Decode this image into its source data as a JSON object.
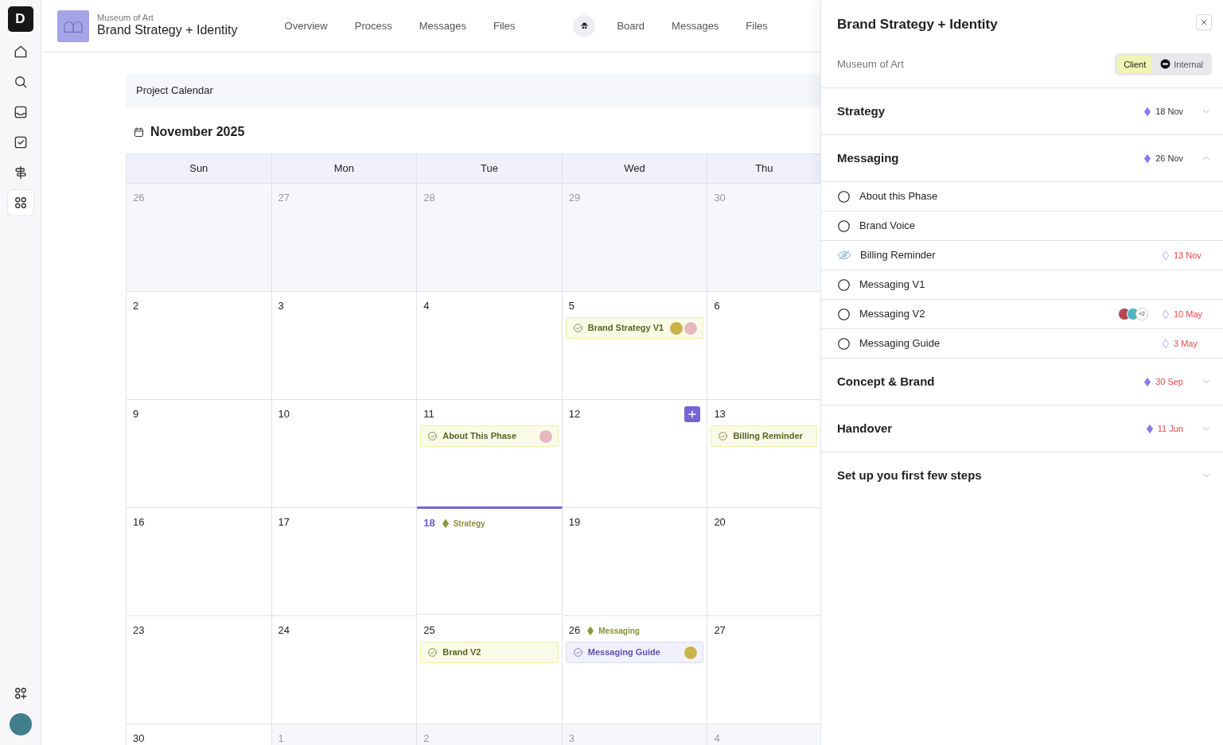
{
  "rail": {
    "logo": "D",
    "items": [
      {
        "kind": "home",
        "selected": false
      },
      {
        "kind": "search",
        "selected": false
      },
      {
        "kind": "inbox",
        "selected": false
      },
      {
        "kind": "tasks",
        "selected": false
      },
      {
        "kind": "signpost",
        "selected": false
      },
      {
        "kind": "apps",
        "selected": true
      }
    ],
    "bottom": [
      {
        "kind": "add-apps"
      },
      {
        "kind": "avatar",
        "color": "#3f7f8c"
      }
    ]
  },
  "header": {
    "org": "Museum of Art",
    "title": "Brand Strategy + Identity",
    "tabs": [
      {
        "label": "Overview",
        "selected": false
      },
      {
        "label": "Process",
        "selected": false
      },
      {
        "label": "Messages",
        "selected": false
      },
      {
        "label": "Files",
        "selected": false
      }
    ],
    "internal_tabs": [
      {
        "label": "Board",
        "selected": false
      },
      {
        "label": "Messages",
        "selected": false
      },
      {
        "label": "Files",
        "selected": false
      }
    ]
  },
  "calendar": {
    "title": "Project Calendar",
    "month": "November 2025",
    "weekdays": [
      "Sun",
      "Mon",
      "Tue",
      "Wed",
      "Thu"
    ],
    "weeks": [
      [
        {
          "day": "26",
          "muted": true
        },
        {
          "day": "27",
          "muted": true
        },
        {
          "day": "28",
          "muted": true
        },
        {
          "day": "29",
          "muted": true
        },
        {
          "day": "30",
          "muted": true
        }
      ],
      [
        {
          "day": "2",
          "muted": false
        },
        {
          "day": "3",
          "muted": false
        },
        {
          "day": "4",
          "muted": false
        },
        {
          "day": "5",
          "muted": false,
          "events": [
            {
              "label": "Brand Strategy V1",
              "color": "#fafbe6",
              "avatars": [
                {
                  "color": "#c9b34a"
                },
                {
                  "color": "#e6b8bd"
                }
              ]
            }
          ]
        },
        {
          "day": "6",
          "muted": false
        }
      ],
      [
        {
          "day": "9",
          "muted": false
        },
        {
          "day": "10",
          "muted": false
        },
        {
          "day": "11",
          "muted": false,
          "events": [
            {
              "label": "About This Phase",
              "color": "#fafbe6",
              "avatars": [
                {
                  "color": "#e6b8bd"
                }
              ]
            }
          ]
        },
        {
          "day": "12",
          "muted": false,
          "add_button": true
        },
        {
          "day": "13",
          "muted": false,
          "events": [
            {
              "label": "Billing Reminder",
              "color": "#fafbe6"
            }
          ]
        }
      ],
      [
        {
          "day": "16",
          "muted": false
        },
        {
          "day": "17",
          "muted": false
        },
        {
          "day": "18",
          "muted": false,
          "today": true,
          "milestone": "Strategy"
        },
        {
          "day": "19",
          "muted": false
        },
        {
          "day": "20",
          "muted": false
        }
      ],
      [
        {
          "day": "23",
          "muted": false
        },
        {
          "day": "24",
          "muted": false
        },
        {
          "day": "25",
          "muted": false,
          "events": [
            {
              "label": "Brand V2",
              "color": "#fafbe6"
            }
          ]
        },
        {
          "day": "26",
          "muted": false,
          "milestone": "Messaging",
          "events": [
            {
              "label": "Messaging Guide",
              "color": "#f1f0fd",
              "avatars": [
                {
                  "color": "#c9b34a"
                }
              ]
            }
          ]
        },
        {
          "day": "27",
          "muted": false
        }
      ],
      [
        {
          "day": "30",
          "muted": false
        },
        {
          "day": "1",
          "muted": true
        },
        {
          "day": "2",
          "muted": true
        },
        {
          "day": "3",
          "muted": true
        },
        {
          "day": "4",
          "muted": true
        }
      ]
    ]
  },
  "panel": {
    "title": "Brand Strategy + Identity",
    "subtitle": "Museum of Art",
    "audience": [
      {
        "label": "Client",
        "selected": true
      },
      {
        "label": "Internal",
        "selected": false
      }
    ],
    "sections": [
      {
        "name": "Strategy",
        "date": "18 Nov",
        "overdue": false,
        "expanded": false
      },
      {
        "name": "Messaging",
        "date": "26 Nov",
        "overdue": false,
        "expanded": true,
        "items": [
          {
            "name": "About this Phase",
            "kind": "task"
          },
          {
            "name": "Brand Voice",
            "kind": "task"
          },
          {
            "name": "Billing Reminder",
            "kind": "hidden",
            "date": "13 Nov"
          },
          {
            "name": "Messaging V1",
            "kind": "task"
          },
          {
            "name": "Messaging V2",
            "kind": "task",
            "date": "10 May",
            "avatars": [
              {
                "color": "#b5474f"
              },
              {
                "color": "#4fb3c0"
              }
            ],
            "more": "+2"
          },
          {
            "name": "Messaging Guide",
            "kind": "task",
            "date": "3 May"
          }
        ]
      },
      {
        "name": "Concept & Brand",
        "date": "30 Sep",
        "overdue": true,
        "expanded": false
      },
      {
        "name": "Handover",
        "date": "11 Jun",
        "overdue": true,
        "expanded": false
      },
      {
        "name": "Set up you first few steps",
        "expanded": false
      }
    ]
  }
}
